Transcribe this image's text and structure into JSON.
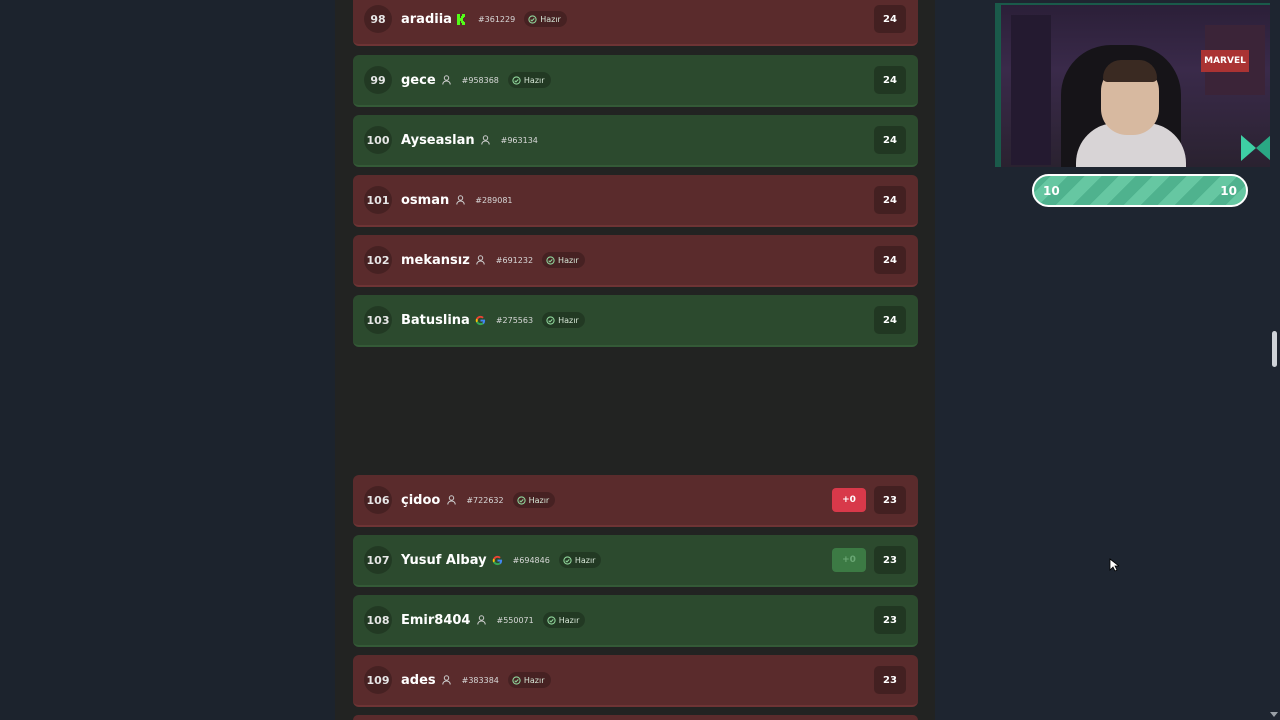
{
  "leaderboard": {
    "rows": [
      {
        "rank": "98",
        "name": "aradiia",
        "icon": "kick-icon",
        "uid": "#361229",
        "status": "Hazır",
        "score": "24",
        "color": "red"
      },
      {
        "rank": "99",
        "name": "gece",
        "icon": "user-icon",
        "uid": "#958368",
        "status": "Hazır",
        "score": "24",
        "color": "green"
      },
      {
        "rank": "100",
        "name": "Ayseaslan",
        "icon": "user-icon",
        "uid": "#963134",
        "status": "",
        "score": "24",
        "color": "green"
      },
      {
        "rank": "101",
        "name": "osman",
        "icon": "user-icon",
        "uid": "#289081",
        "status": "",
        "score": "24",
        "color": "red"
      },
      {
        "rank": "102",
        "name": "mekansız",
        "icon": "user-icon",
        "uid": "#691232",
        "status": "Hazır",
        "score": "24",
        "color": "red"
      },
      {
        "rank": "103",
        "name": "Batuslina",
        "icon": "google-icon",
        "uid": "#275563",
        "status": "Hazır",
        "score": "24",
        "color": "green"
      },
      {
        "rank": "106",
        "name": "çidoo",
        "icon": "user-icon",
        "uid": "#722632",
        "status": "Hazır",
        "score": "23",
        "color": "red",
        "delta": "+0",
        "delta_color": "red"
      },
      {
        "rank": "107",
        "name": "Yusuf Albay",
        "icon": "google-icon",
        "uid": "#694846",
        "status": "Hazır",
        "score": "23",
        "color": "green",
        "delta": "+0",
        "delta_color": "green"
      },
      {
        "rank": "108",
        "name": "Emir8404",
        "icon": "user-icon",
        "uid": "#550071",
        "status": "Hazır",
        "score": "23",
        "color": "green"
      },
      {
        "rank": "109",
        "name": "ades",
        "icon": "user-icon",
        "uid": "#383384",
        "status": "Hazır",
        "score": "23",
        "color": "red"
      }
    ]
  },
  "overlay": {
    "progress_left": "10",
    "progress_right": "10",
    "webcam_poster": "MARVEL"
  },
  "colors": {
    "row_red": "#5a2b2c",
    "row_green": "#2c4a2e",
    "delta_red": "#d8394a",
    "accent": "#4fb28e"
  }
}
